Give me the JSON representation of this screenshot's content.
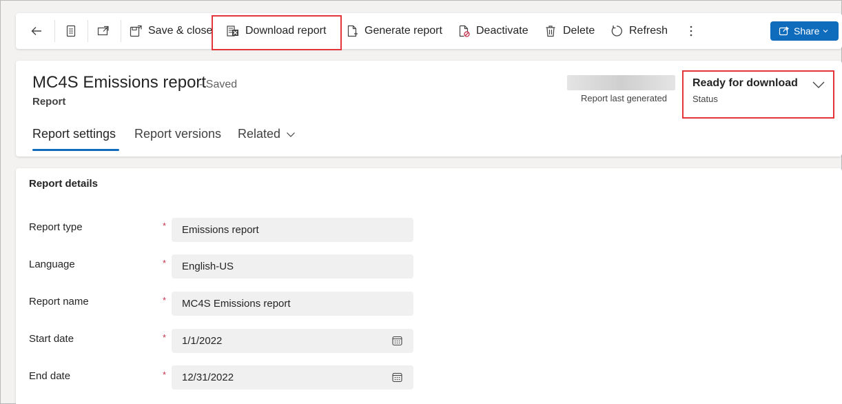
{
  "toolbar": {
    "back_icon": "arrow-left-icon",
    "form_icon": "form-icon",
    "popout_icon": "open-in-new-window-icon",
    "save_close_label": "Save & close",
    "download_report_label": "Download report",
    "generate_report_label": "Generate report",
    "deactivate_label": "Deactivate",
    "delete_label": "Delete",
    "refresh_label": "Refresh",
    "more_icon": "more-vertical-icon",
    "share_label": "Share"
  },
  "header": {
    "title": "MC4S Emissions report",
    "save_state": "- Saved",
    "entity": "Report",
    "last_generated_label": "Report last generated",
    "status_value": "Ready for download",
    "status_label": "Status"
  },
  "tabs": [
    {
      "label": "Report settings",
      "active": true
    },
    {
      "label": "Report versions",
      "active": false
    },
    {
      "label": "Related",
      "active": false
    }
  ],
  "details": {
    "section_title": "Report details",
    "fields": [
      {
        "label": "Report type",
        "value": "Emissions report",
        "required": true
      },
      {
        "label": "Language",
        "value": "English-US",
        "required": true
      },
      {
        "label": "Report name",
        "value": "MC4S Emissions report",
        "required": true
      },
      {
        "label": "Start date",
        "value": "1/1/2022",
        "required": true
      },
      {
        "label": "End date",
        "value": "12/31/2022",
        "required": true
      }
    ],
    "required_marker": "*"
  },
  "colors": {
    "accent": "#0f6cbd",
    "highlight_border": "#e3343a",
    "required": "#c4314b"
  }
}
